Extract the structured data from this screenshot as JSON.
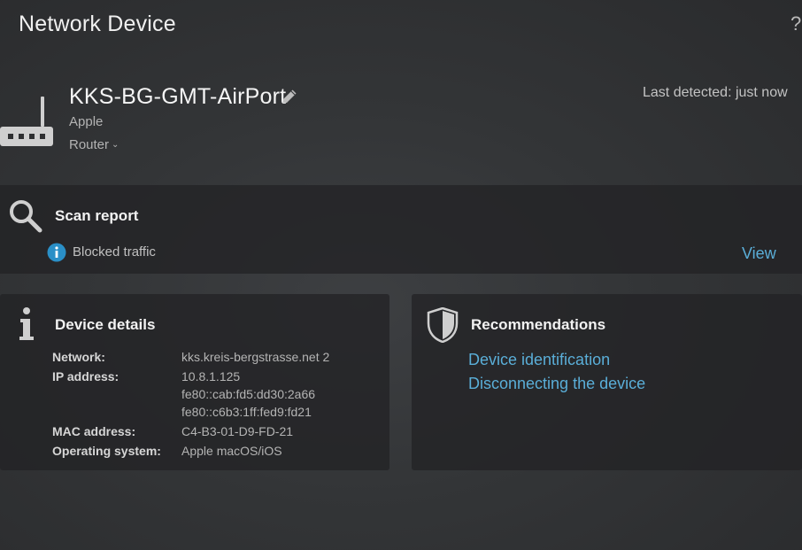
{
  "header": {
    "title": "Network Device",
    "help_label": "?"
  },
  "device": {
    "name": "KKS-BG-GMT-AirPort",
    "vendor": "Apple",
    "type": "Router",
    "last_detected": "Last detected: just now",
    "icon": "router-icon",
    "edit_icon": "pencil-icon"
  },
  "scan_report": {
    "title": "Scan report",
    "icon": "search-icon",
    "status_icon": "info-icon",
    "status_text": "Blocked traffic",
    "view_label": "View"
  },
  "details": {
    "title": "Device details",
    "icon": "info-icon",
    "network_label": "Network:",
    "network_value": "kks.kreis-bergstrasse.net 2",
    "ip_label": "IP address:",
    "ip_values": [
      "10.8.1.125",
      "fe80::cab:fd5:dd30:2a66",
      "fe80::c6b3:1ff:fed9:fd21"
    ],
    "mac_label": "MAC address:",
    "mac_value": "C4-B3-01-D9-FD-21",
    "os_label": "Operating system:",
    "os_value": "Apple macOS/iOS"
  },
  "recommendations": {
    "title": "Recommendations",
    "icon": "shield-icon",
    "links": [
      "Device identification",
      "Disconnecting the device"
    ]
  },
  "colors": {
    "link": "#5aaed8",
    "info_badge": "#2a8fc7",
    "panel": "#232426"
  }
}
